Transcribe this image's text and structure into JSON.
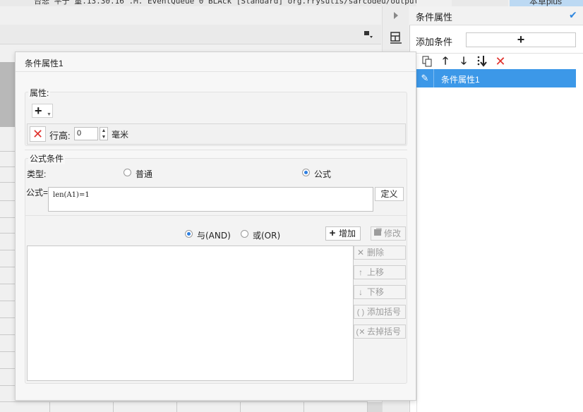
{
  "background": {
    "title_fragment": "台悲 平于 量.13.30.16 .M. EventQueue 0 BLAck [Standard] org.rrysulis/sarcodeu/output/canvasPlo.raer",
    "publish_label": "本草plus"
  },
  "right_panel": {
    "title": "条件属性",
    "add_condition_label": "添加条件",
    "add_button_symbol": "+",
    "toolbar_icons": [
      "copy-icon",
      "arrow-up-icon",
      "arrow-down-icon",
      "move-bottom-icon",
      "delete-icon"
    ],
    "conditions": [
      {
        "label": "条件属性1",
        "selected": true
      }
    ]
  },
  "dialog": {
    "title": "条件属性1",
    "attributes": {
      "section_label": "属性:",
      "add_symbol": "+",
      "row_height_label": "行高:",
      "row_height_value": "0",
      "row_height_unit": "毫米"
    },
    "formula_condition": {
      "section_label": "公式条件",
      "type_label": "类型:",
      "option_normal": "普通",
      "option_formula": "公式",
      "selected_type": "公式",
      "formula_label": "公式=",
      "formula_value": "len(A1)=1",
      "define_button": "定义",
      "logic_and": "与(AND)",
      "logic_or": "或(OR)",
      "selected_logic": "与(AND)",
      "buttons": {
        "add": "增加",
        "modify": "修改",
        "delete": "删除",
        "move_up": "上移",
        "move_down": "下移",
        "add_bracket": "添加括号",
        "remove_bracket": "去掉括号"
      }
    }
  },
  "colors": {
    "accent": "#3c98e8",
    "delete_red": "#e0322d",
    "radio_blue": "#2e7fe0"
  }
}
